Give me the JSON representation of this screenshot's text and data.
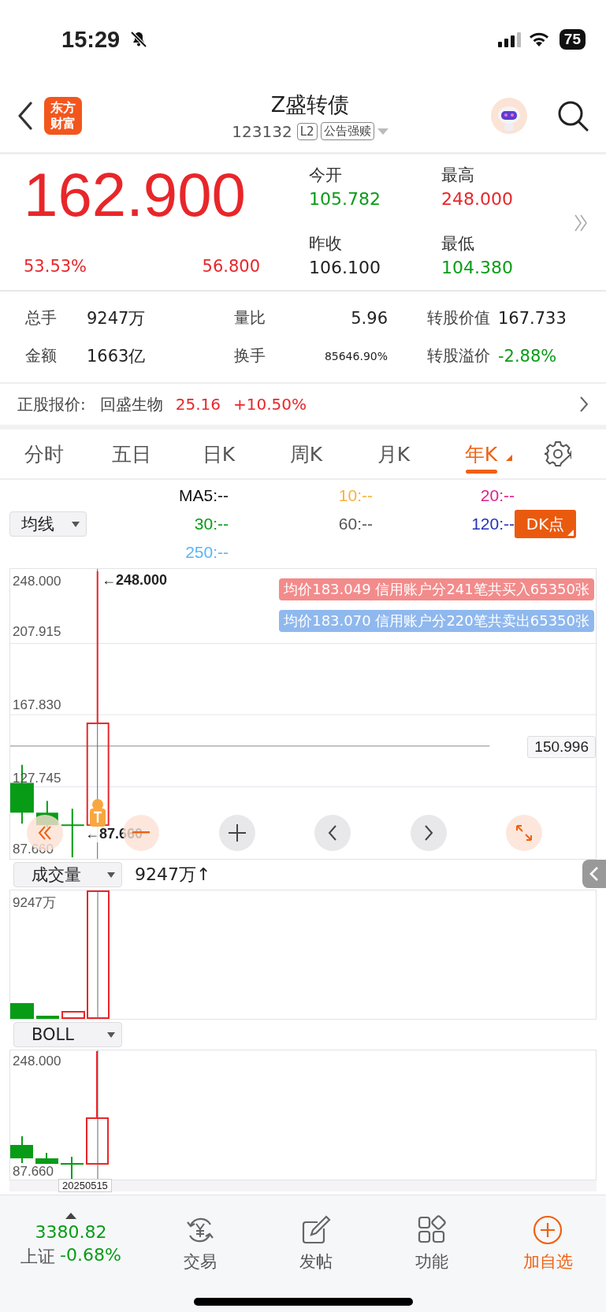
{
  "status_bar": {
    "time": "15:29",
    "battery": "75"
  },
  "header": {
    "logo": "东方财富",
    "title": "Z盛转债",
    "code": "123132",
    "badges": [
      "L2",
      "公告强赎"
    ]
  },
  "quote": {
    "price": "162.900",
    "change_pct": "53.53%",
    "change": "56.800",
    "fields": [
      {
        "label": "今开",
        "value": "105.782",
        "color": "#089c16"
      },
      {
        "label": "最高",
        "value": "248.000",
        "color": "#e8262a"
      },
      {
        "label": "昨收",
        "value": "106.100",
        "color": "#222222"
      },
      {
        "label": "最低",
        "value": "104.380",
        "color": "#089c16"
      }
    ]
  },
  "stats": [
    {
      "label": "总手",
      "value": "9247万",
      "color": "#222222"
    },
    {
      "label": "量比",
      "value": "5.96",
      "color": "#222222"
    },
    {
      "label": "转股价值",
      "value": "167.733",
      "color": "#222222"
    },
    {
      "label": "金额",
      "value": "1663亿",
      "color": "#222222"
    },
    {
      "label": "换手",
      "value": "85646.90%",
      "color": "#222222"
    },
    {
      "label": "转股溢价",
      "value": "-2.88%",
      "color": "#089c16"
    }
  ],
  "underlying": {
    "label": "正股报价:",
    "name": "回盛生物",
    "price": "25.16",
    "change": "+10.50%"
  },
  "tabs": [
    {
      "label": "分时",
      "selected": false
    },
    {
      "label": "五日",
      "selected": false
    },
    {
      "label": "日K",
      "selected": false
    },
    {
      "label": "周K",
      "selected": false
    },
    {
      "label": "月K",
      "selected": false
    },
    {
      "label": "年K",
      "selected": true
    }
  ],
  "ma_selector": "均线",
  "ma_values": [
    {
      "label": "MA5:--",
      "color": "#111111"
    },
    {
      "label": "10:--",
      "color": "#f9b23c"
    },
    {
      "label": "20:--",
      "color": "#e0208a"
    },
    {
      "label": "30:--",
      "color": "#089c16"
    },
    {
      "label": "60:--",
      "color": "#555555"
    },
    {
      "label": "120:--",
      "color": "#2233bb"
    },
    {
      "label": "250:--",
      "color": "#5ab4f5"
    }
  ],
  "dk_button": "DK点",
  "main_chart": {
    "y_labels": [
      "248.000",
      "207.915",
      "167.830",
      "127.745",
      "87.660"
    ],
    "high_marker": "←248.000",
    "low_marker": "←87.660",
    "ref_price": "150.996",
    "banners": [
      {
        "text": "均价183.049 信用账户分241笔共买入65350张",
        "color": "#f38b8b"
      },
      {
        "text": "均价183.070 信用账户分220笔共卖出65350张",
        "color": "#8fb8ee"
      }
    ]
  },
  "volume": {
    "selector": "成交量",
    "reading": "9247万↑",
    "y_label": "9247万"
  },
  "indicator": {
    "selector": "BOLL",
    "y_labels": [
      "248.000",
      "87.660"
    ],
    "date": "20250515"
  },
  "bottom_bar": {
    "index_value": "3380.82",
    "index_name": "上证",
    "index_change": "-0.68%",
    "items": [
      {
        "label": "交易",
        "kind": "trade",
        "accent": false
      },
      {
        "label": "发帖",
        "kind": "post",
        "accent": false
      },
      {
        "label": "功能",
        "kind": "functions",
        "accent": false
      },
      {
        "label": "加自选",
        "kind": "add",
        "accent": true
      }
    ]
  }
}
